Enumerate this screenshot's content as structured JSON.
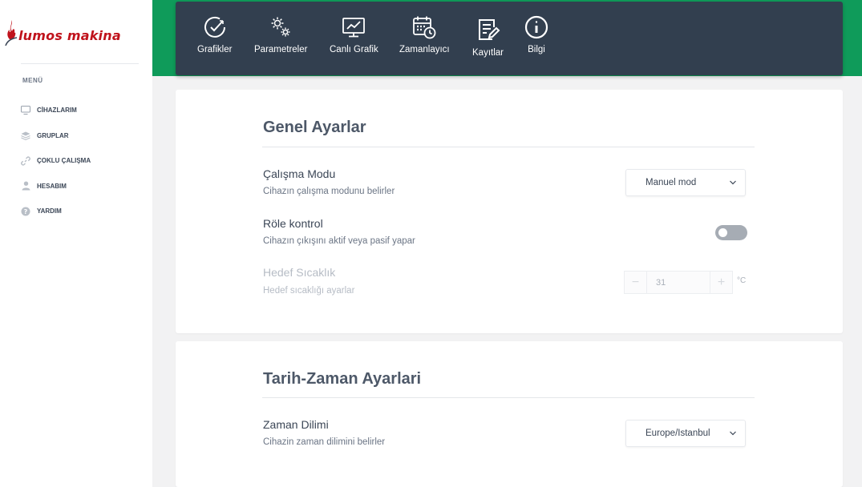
{
  "brand": {
    "name": "lumos makina",
    "color": "#c0131c"
  },
  "sidebar": {
    "menu_title": "MENÜ",
    "items": [
      {
        "label": "CİHAZLARIM",
        "icon": "monitor-icon"
      },
      {
        "label": "GRUPLAR",
        "icon": "layers-icon"
      },
      {
        "label": "ÇOKLU ÇALIŞMA",
        "icon": "link-icon"
      },
      {
        "label": "HESABIM",
        "icon": "user-icon"
      },
      {
        "label": "YARDIM",
        "icon": "help-icon"
      }
    ]
  },
  "toolbar": {
    "items": [
      {
        "label": "Grafikler",
        "icon": "gauge-icon"
      },
      {
        "label": "Parametreler",
        "icon": "gears-icon"
      },
      {
        "label": "Canlı Grafik",
        "icon": "live-chart-icon"
      },
      {
        "label": "Zamanlayıcı",
        "icon": "calendar-clock-icon"
      },
      {
        "label": "Kayıtlar",
        "icon": "records-icon"
      },
      {
        "label": "Bilgi",
        "icon": "info-icon"
      }
    ]
  },
  "general_settings": {
    "title": "Genel Ayarlar",
    "mode": {
      "label": "Çalışma Modu",
      "description": "Cihazın çalışma modunu belirler",
      "value": "Manuel mod"
    },
    "relay": {
      "label": "Röle kontrol",
      "description": "Cihazın çıkışını aktif veya pasif yapar",
      "enabled": false
    },
    "target_temp": {
      "label": "Hedef Sıcaklık",
      "description": "Hedef sıcaklığı ayarlar",
      "value": "31",
      "unit": "°C",
      "minus": "−",
      "plus": "+"
    }
  },
  "datetime_settings": {
    "title": "Tarih-Zaman Ayarlari",
    "timezone": {
      "label": "Zaman Dilimi",
      "description": "Cihazin zaman dilimini belirler",
      "value": "Europe/Istanbul"
    }
  },
  "colors": {
    "header_green": "#0f9b5a",
    "toolbar_bg": "#323f4f",
    "page_bg": "#f2f2f3"
  }
}
